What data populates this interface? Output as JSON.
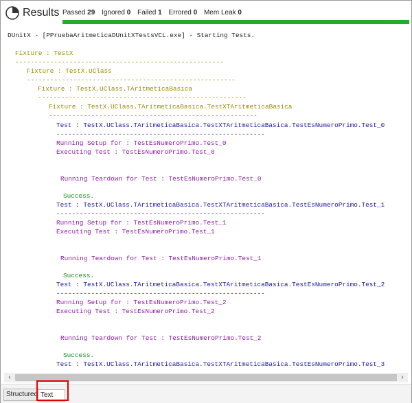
{
  "header": {
    "title": "Results",
    "stats": [
      {
        "label": "Passed",
        "value": "29"
      },
      {
        "label": "Ignored",
        "value": "0"
      },
      {
        "label": "Failed",
        "value": "1"
      },
      {
        "label": "Errored",
        "value": "0"
      },
      {
        "label": "Mem Leak",
        "value": "0"
      }
    ],
    "progress_fraction": 1.0,
    "progress_color": "#1fae2a"
  },
  "log": {
    "lines": [
      {
        "text": "DUnitX - [PPruebaAritmeticaDUnitXTestsVCL.exe] - Starting Tests.",
        "color": "black"
      },
      {
        "text": "Fixture : TestX",
        "color": "olive"
      },
      {
        "text": "------------------------------------------------------",
        "color": "olive"
      },
      {
        "text": "Fixture : TestX.UClass",
        "color": "olive"
      },
      {
        "text": "------------------------------------------------------",
        "color": "olive"
      },
      {
        "text": "Fixture : TestX.UClass.TAritmeticaBasica",
        "color": "olive"
      },
      {
        "text": "------------------------------------------------------",
        "color": "olive"
      },
      {
        "text": "Fixture : TestX.UClass.TAritmeticaBasica.TestXTAritmeticaBasica",
        "color": "olive"
      },
      {
        "text": "------------------------------------------------------",
        "color": "olive"
      },
      {
        "text": "Test : TestX.UClass.TAritmeticaBasica.TestXTAritmeticaBasica.TestEsNumeroPrimo.Test_0",
        "color": "navy"
      },
      {
        "text": "------------------------------------------------------",
        "color": "navy"
      },
      {
        "text": "Running Setup for : TestEsNumeroPrimo.Test_0",
        "color": "purple"
      },
      {
        "text": "Executing Test : TestEsNumeroPrimo.Test_0",
        "color": "purple"
      },
      {
        "text": "Running Teardown for Test : TestEsNumeroPrimo.Test_0",
        "color": "purple"
      },
      {
        "text": "Success.",
        "color": "green"
      },
      {
        "text": "Test : TestX.UClass.TAritmeticaBasica.TestXTAritmeticaBasica.TestEsNumeroPrimo.Test_1",
        "color": "navy"
      },
      {
        "text": "------------------------------------------------------",
        "color": "navy"
      },
      {
        "text": "Running Setup for : TestEsNumeroPrimo.Test_1",
        "color": "purple"
      },
      {
        "text": "Executing Test : TestEsNumeroPrimo.Test_1",
        "color": "purple"
      },
      {
        "text": "Running Teardown for Test : TestEsNumeroPrimo.Test_1",
        "color": "purple"
      },
      {
        "text": "Success.",
        "color": "green"
      },
      {
        "text": "Test : TestX.UClass.TAritmeticaBasica.TestXTAritmeticaBasica.TestEsNumeroPrimo.Test_2",
        "color": "navy"
      },
      {
        "text": "------------------------------------------------------",
        "color": "navy"
      },
      {
        "text": "Running Setup for : TestEsNumeroPrimo.Test_2",
        "color": "purple"
      },
      {
        "text": "Executing Test : TestEsNumeroPrimo.Test_2",
        "color": "purple"
      },
      {
        "text": "Running Teardown for Test : TestEsNumeroPrimo.Test_2",
        "color": "purple"
      },
      {
        "text": "Success.",
        "color": "green"
      },
      {
        "text": "Test : TestX.UClass.TAritmeticaBasica.TestXTAritmeticaBasica.TestEsNumeroPrimo.Test_3",
        "color": "navy"
      }
    ]
  },
  "tabs": {
    "structured_label": "Structured",
    "text_label": "Text",
    "active": "Text"
  },
  "scrollbar": {
    "left_arrow": "‹",
    "right_arrow": "›"
  }
}
